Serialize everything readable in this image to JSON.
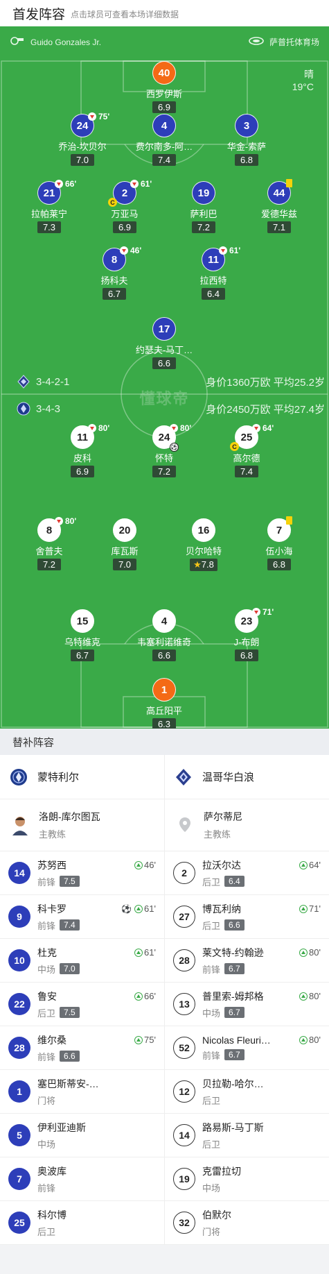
{
  "header": {
    "title": "首发阵容",
    "subtitle": "点击球员可查看本场详细数据"
  },
  "match_info": {
    "referee": "Guido Gonzales Jr.",
    "referee_icon": "whistle-icon",
    "stadium": "萨普托体育场",
    "stadium_icon": "stadium-icon",
    "weather": "晴",
    "temperature": "19°C"
  },
  "watermark": "懂球帝",
  "away_team_formation": {
    "formation": "3-4-2-1",
    "value": "身价1360万欧 平均25.2岁"
  },
  "home_team_formation": {
    "formation": "3-4-3",
    "value": "身价2450万欧 平均27.4岁"
  },
  "away_players": [
    {
      "number": "40",
      "name": "西罗伊斯",
      "rating": "6.9",
      "gk": true
    },
    {
      "number": "24",
      "name": "乔治-坎贝尔",
      "rating": "7.0",
      "sub": "75'"
    },
    {
      "number": "4",
      "name": "费尔南多-阿…",
      "rating": "7.4"
    },
    {
      "number": "3",
      "name": "华金-索萨",
      "rating": "6.8"
    },
    {
      "number": "21",
      "name": "拉帕莱宁",
      "rating": "7.3",
      "sub": "66'"
    },
    {
      "number": "2",
      "name": "万亚马",
      "rating": "6.9",
      "sub": "61'",
      "captain": "C"
    },
    {
      "number": "19",
      "name": "萨利巴",
      "rating": "7.2"
    },
    {
      "number": "44",
      "name": "爱德华兹",
      "rating": "7.1",
      "yellow": true
    },
    {
      "number": "8",
      "name": "扬科夫",
      "rating": "6.7",
      "sub": "46'"
    },
    {
      "number": "11",
      "name": "拉西特",
      "rating": "6.4",
      "sub": "61'"
    },
    {
      "number": "17",
      "name": "约瑟夫-马丁…",
      "rating": "6.6"
    }
  ],
  "home_players": [
    {
      "number": "11",
      "name": "皮科",
      "rating": "6.9",
      "sub": "80'"
    },
    {
      "number": "24",
      "name": "怀特",
      "rating": "7.2",
      "sub": "80'",
      "goal": true
    },
    {
      "number": "25",
      "name": "高尔德",
      "rating": "7.4",
      "sub": "64'",
      "captain": "C"
    },
    {
      "number": "8",
      "name": "舍普夫",
      "rating": "7.2",
      "sub": "80'"
    },
    {
      "number": "20",
      "name": "库瓦斯",
      "rating": "7.0"
    },
    {
      "number": "16",
      "name": "贝尔哈特",
      "rating": "7.8",
      "star": true
    },
    {
      "number": "7",
      "name": "伍小海",
      "rating": "6.8",
      "yellow": true
    },
    {
      "number": "15",
      "name": "乌特维克",
      "rating": "6.7"
    },
    {
      "number": "4",
      "name": "韦塞利诺维奇",
      "rating": "6.6"
    },
    {
      "number": "23",
      "name": "J-布朗",
      "rating": "6.8",
      "sub": "71'"
    },
    {
      "number": "1",
      "name": "高丘阳平",
      "rating": "6.3",
      "gk": true
    }
  ],
  "substitutes": {
    "title": "替补阵容",
    "left_team": {
      "name": "蒙特利尔",
      "crest": "montreal-crest-icon",
      "coach": "洛朗-库尔图瓦",
      "coach_role": "主教练"
    },
    "right_team": {
      "name": "温哥华白浪",
      "crest": "vancouver-crest-icon",
      "coach": "萨尔蒂尼",
      "coach_role": "主教练"
    },
    "left": [
      {
        "number": "14",
        "name": "苏努西",
        "pos": "前锋",
        "rating": "7.5",
        "in": "46'"
      },
      {
        "number": "9",
        "name": "科卡罗",
        "pos": "前锋",
        "rating": "7.4",
        "in": "61'",
        "goal": true
      },
      {
        "number": "10",
        "name": "杜克",
        "pos": "中场",
        "rating": "7.0",
        "in": "61'"
      },
      {
        "number": "22",
        "name": "鲁安",
        "pos": "后卫",
        "rating": "7.5",
        "in": "66'"
      },
      {
        "number": "28",
        "name": "维尔桑",
        "pos": "前锋",
        "rating": "6.6",
        "in": "75'"
      },
      {
        "number": "1",
        "name": "塞巴斯蒂安-…",
        "pos": "门将"
      },
      {
        "number": "5",
        "name": "伊利亚迪斯",
        "pos": "中场"
      },
      {
        "number": "7",
        "name": "奥波库",
        "pos": "前锋"
      },
      {
        "number": "25",
        "name": "科尔博",
        "pos": "后卫"
      }
    ],
    "right": [
      {
        "number": "2",
        "name": "拉沃尔达",
        "pos": "后卫",
        "rating": "6.4",
        "in": "64'"
      },
      {
        "number": "27",
        "name": "博瓦利纳",
        "pos": "后卫",
        "rating": "6.6",
        "in": "71'"
      },
      {
        "number": "28",
        "name": "莱文特-约翰逊",
        "pos": "前锋",
        "rating": "6.7",
        "in": "80'"
      },
      {
        "number": "13",
        "name": "普里索-姆邦格",
        "pos": "中场",
        "rating": "6.7",
        "in": "80'"
      },
      {
        "number": "52",
        "name": "Nicolas Fleuri…",
        "pos": "前锋",
        "rating": "6.7",
        "in": "80'"
      },
      {
        "number": "12",
        "name": "贝拉勒-哈尔…",
        "pos": "后卫"
      },
      {
        "number": "14",
        "name": "路易斯-马丁斯",
        "pos": "后卫"
      },
      {
        "number": "19",
        "name": "克雷拉切",
        "pos": "中场"
      },
      {
        "number": "32",
        "name": "伯默尔",
        "pos": "门将"
      }
    ]
  },
  "colors": {
    "pitch": "#3aaa48",
    "away": "#2d3eb9",
    "goalkeeper": "#f46a16",
    "yellow_card": "#f5d20a"
  }
}
